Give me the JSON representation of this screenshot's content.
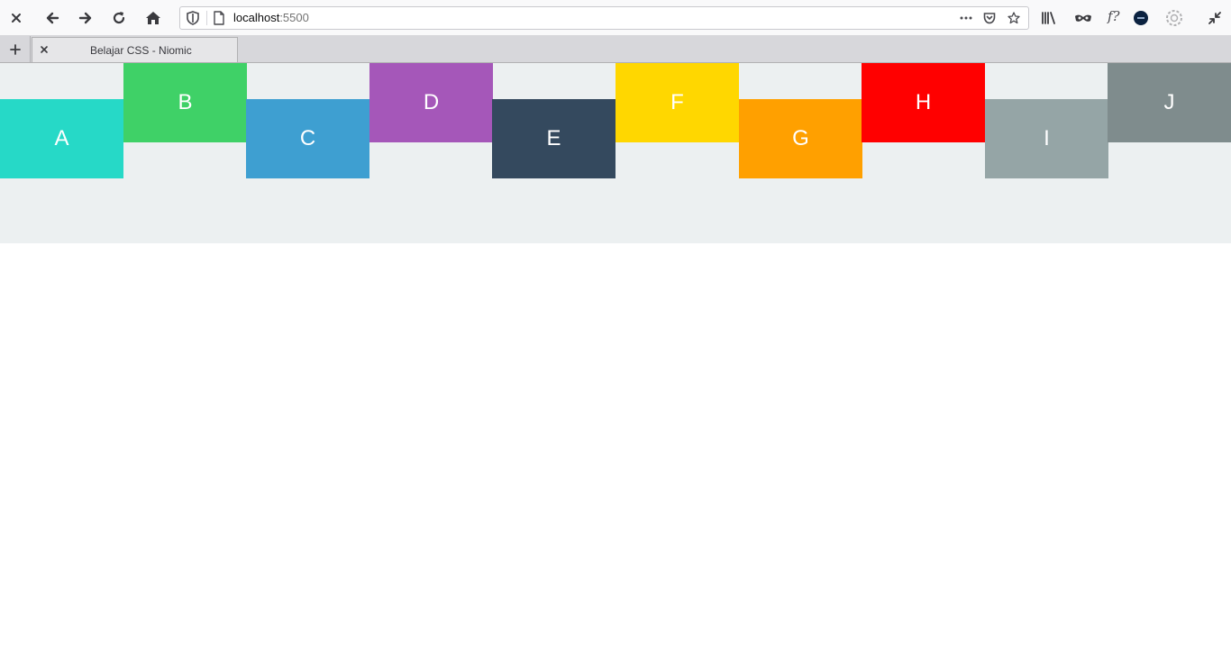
{
  "toolbar": {
    "close_icon": "close-icon",
    "back_icon": "arrow-left-icon",
    "forward_icon": "arrow-right-icon",
    "reload_icon": "reload-icon",
    "home_icon": "home-icon",
    "url_host": "localhost",
    "url_port": ":5500",
    "page_actions_icon": "more-horizontal-icon",
    "pocket_icon": "pocket-icon",
    "bookmark_icon": "star-icon",
    "library_icon": "library-icon",
    "private_icon": "mask-icon",
    "fx_label": "f?",
    "account_icon": "avatar-icon",
    "settings_icon": "gear-icon",
    "restore_icon": "collapse-icon"
  },
  "tabs": [
    {
      "title": "Belajar CSS - Niomic"
    }
  ],
  "boxes": [
    {
      "label": "A",
      "color": "#26d9c7"
    },
    {
      "label": "B",
      "color": "#3fd167"
    },
    {
      "label": "C",
      "color": "#3e9fd1"
    },
    {
      "label": "D",
      "color": "#a557b9"
    },
    {
      "label": "E",
      "color": "#34495e"
    },
    {
      "label": "F",
      "color": "#ffd700"
    },
    {
      "label": "G",
      "color": "#ffa000"
    },
    {
      "label": "H",
      "color": "#ff0000"
    },
    {
      "label": "I",
      "color": "#95a5a6"
    },
    {
      "label": "J",
      "color": "#7f8c8d"
    }
  ],
  "colors": {
    "container_bg": "#ecf0f1",
    "box_text": "#ffffff"
  }
}
